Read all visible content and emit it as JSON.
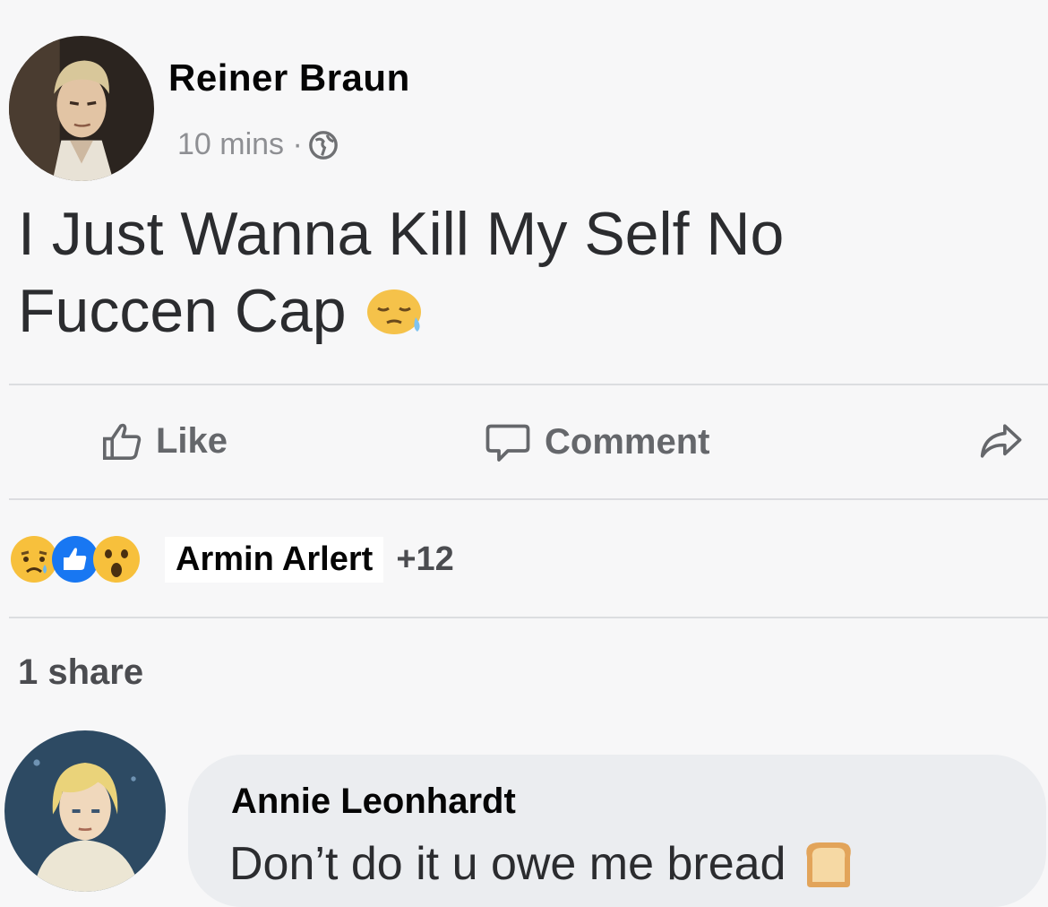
{
  "post": {
    "author": "Reiner Braun",
    "time": "10 mins ·",
    "text_line1": "I Just Wanna Kill My Self No",
    "text_line2": "Fuccen Cap",
    "emoji": "sleepy-face-icon"
  },
  "actions": {
    "like_label": "Like",
    "comment_label": "Comment",
    "share_icon": "share-arrow-icon"
  },
  "reactions": {
    "icons": [
      "sad-reaction-icon",
      "like-reaction-icon",
      "wow-reaction-icon"
    ],
    "name": "Armin Arlert",
    "count": "+12"
  },
  "shares": "1 share",
  "comment": {
    "author": "Annie Leonhardt",
    "text": "Don’t do it u owe me bread",
    "emoji": "bread-icon"
  },
  "colors": {
    "background": "#f7f7f8",
    "comment_bubble": "#ebedf0",
    "like_blue": "#1877f2",
    "reaction_yellow": "#f7c03c",
    "muted_text": "#65676b"
  }
}
